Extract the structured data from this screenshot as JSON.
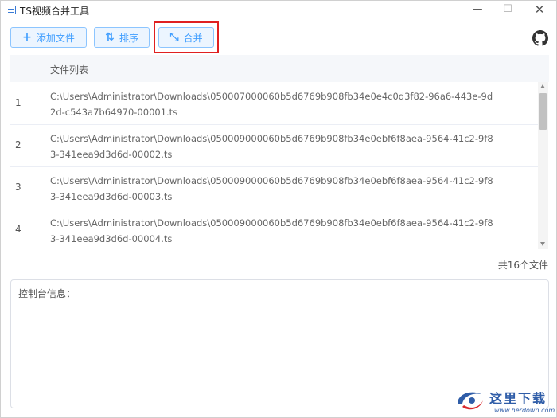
{
  "window": {
    "title": "TS视频合并工具",
    "minimize_glyph": "—",
    "maximize_glyph": "☐",
    "close_glyph": "✕"
  },
  "toolbar": {
    "add_label": "添加文件",
    "add_icon": "+",
    "sort_label": "排序",
    "sort_icon": "⇅",
    "merge_label": "合并",
    "merge_icon": "⤡"
  },
  "table": {
    "header": "文件列表",
    "rows": [
      {
        "index": "1",
        "path": "C:\\Users\\Administrator\\Downloads\\050007000060b5d6769b908fb34e0e4c0d3f82-96a6-443e-9d2d-c543a7b64970-00001.ts"
      },
      {
        "index": "2",
        "path": "C:\\Users\\Administrator\\Downloads\\050009000060b5d6769b908fb34e0ebf6f8aea-9564-41c2-9f83-341eea9d3d6d-00002.ts"
      },
      {
        "index": "3",
        "path": "C:\\Users\\Administrator\\Downloads\\050009000060b5d6769b908fb34e0ebf6f8aea-9564-41c2-9f83-341eea9d3d6d-00003.ts"
      },
      {
        "index": "4",
        "path": "C:\\Users\\Administrator\\Downloads\\050009000060b5d6769b908fb34e0ebf6f8aea-9564-41c2-9f83-341eea9d3d6d-00004.ts"
      }
    ]
  },
  "file_count": "共16个文件",
  "console": {
    "label": "控制台信息："
  },
  "watermark": {
    "text": "这里下载",
    "url": "www.herdown.com"
  },
  "colors": {
    "accent": "#409eff",
    "highlight": "#e02020"
  }
}
